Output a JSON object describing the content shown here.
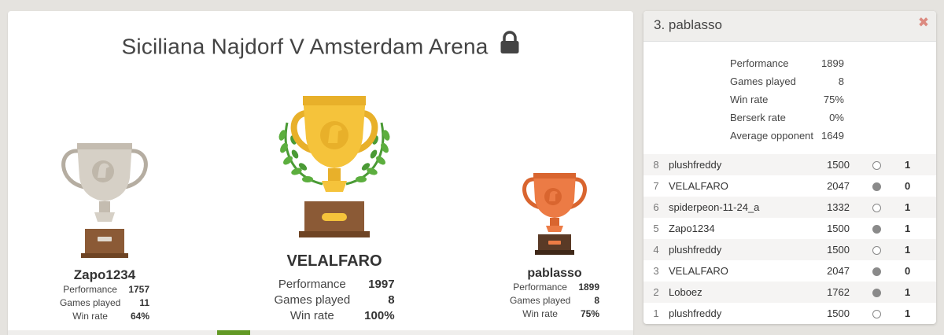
{
  "tournament": {
    "title": "Siciliana Najdorf V Amsterdam Arena"
  },
  "podium": {
    "first": {
      "name": "VELALFARO",
      "stats": [
        {
          "label": "Performance",
          "value": "1997"
        },
        {
          "label": "Games played",
          "value": "8"
        },
        {
          "label": "Win rate",
          "value": "100%"
        }
      ]
    },
    "second": {
      "name": "Zapo1234",
      "stats": [
        {
          "label": "Performance",
          "value": "1757"
        },
        {
          "label": "Games played",
          "value": "11"
        },
        {
          "label": "Win rate",
          "value": "64%"
        }
      ]
    },
    "third": {
      "name": "pablasso",
      "stats": [
        {
          "label": "Performance",
          "value": "1899"
        },
        {
          "label": "Games played",
          "value": "8"
        },
        {
          "label": "Win rate",
          "value": "75%"
        }
      ]
    }
  },
  "player_panel": {
    "title": "3. pablasso",
    "close_glyph": "✖",
    "stats": [
      {
        "label": "Performance",
        "value": "1899"
      },
      {
        "label": "Games played",
        "value": "8"
      },
      {
        "label": "Win rate",
        "value": "75%"
      },
      {
        "label": "Berserk rate",
        "value": "0%"
      },
      {
        "label": "Average opponent",
        "value": "1649"
      }
    ],
    "games": [
      {
        "idx": "8",
        "opponent": "plushfreddy",
        "rating": "1500",
        "color": "white",
        "result": "1"
      },
      {
        "idx": "7",
        "opponent": "VELALFARO",
        "rating": "2047",
        "color": "black",
        "result": "0"
      },
      {
        "idx": "6",
        "opponent": "spiderpeon-11-24_a",
        "rating": "1332",
        "color": "white",
        "result": "1"
      },
      {
        "idx": "5",
        "opponent": "Zapo1234",
        "rating": "1500",
        "color": "black",
        "result": "1"
      },
      {
        "idx": "4",
        "opponent": "plushfreddy",
        "rating": "1500",
        "color": "white",
        "result": "1"
      },
      {
        "idx": "3",
        "opponent": "VELALFARO",
        "rating": "2047",
        "color": "black",
        "result": "0"
      },
      {
        "idx": "2",
        "opponent": "Loboez",
        "rating": "1762",
        "color": "black",
        "result": "1"
      },
      {
        "idx": "1",
        "opponent": "plushfreddy",
        "rating": "1500",
        "color": "white",
        "result": "1"
      }
    ]
  },
  "colors": {
    "gold": "#f5c33b",
    "silver": "#c8c2b8",
    "bronze": "#ec7b45",
    "win": "#629924",
    "loss": "#cc3333"
  }
}
